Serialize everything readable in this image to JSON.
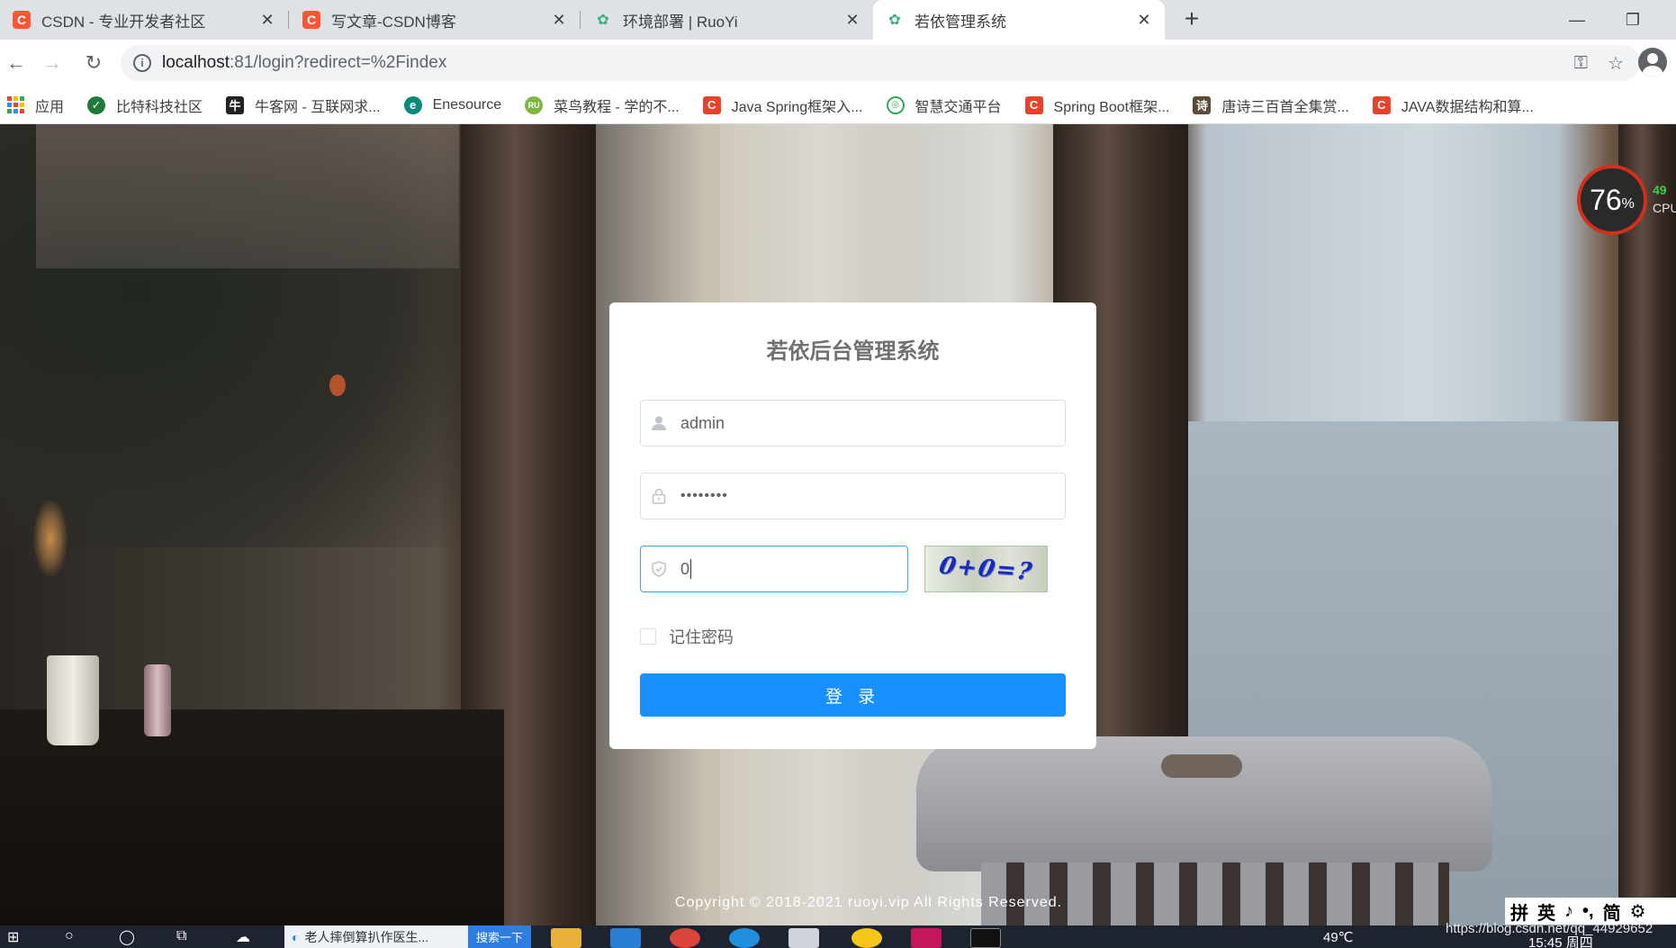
{
  "browser": {
    "tabs": [
      {
        "title": "CSDN - 专业开发者社区",
        "favicon": "C",
        "favicon_color": "#fc5531",
        "active": false
      },
      {
        "title": "写文章-CSDN博客",
        "favicon": "C",
        "favicon_color": "#fc5531",
        "active": false
      },
      {
        "title": "环境部署 | RuoYi",
        "favicon": "ruoyi-leaf-icon",
        "active": false
      },
      {
        "title": "若依管理系统",
        "favicon": "ruoyi-leaf-icon",
        "active": true
      }
    ],
    "new_tab": "+",
    "window_controls": {
      "minimize": "—",
      "restore": "❐"
    },
    "url_host": "localhost",
    "url_rest": ":81/login?redirect=%2Findex",
    "bookmarks": [
      {
        "label": "应用",
        "icon": "apps-grid-icon"
      },
      {
        "label": "比特科技社区",
        "icon": "bite-icon",
        "color": "#1e7b3a"
      },
      {
        "label": "牛客网 - 互联网求...",
        "icon": "nowcoder-icon",
        "color": "#222222"
      },
      {
        "label": "Enesource",
        "icon": "enesource-icon",
        "color": "#0a8a7a"
      },
      {
        "label": "菜鸟教程 - 学的不...",
        "icon": "runoob-icon",
        "color": "#7fb640"
      },
      {
        "label": "Java Spring框架入...",
        "icon": "csdn-icon",
        "color": "#e8412c"
      },
      {
        "label": "智慧交通平台",
        "icon": "traffic-icon",
        "color": "#3aa856"
      },
      {
        "label": "Spring Boot框架...",
        "icon": "csdn-icon",
        "color": "#e8412c"
      },
      {
        "label": "唐诗三百首全集赏...",
        "icon": "poem-icon",
        "color": "#5a4a3a"
      },
      {
        "label": "JAVA数据结构和算...",
        "icon": "csdn-icon",
        "color": "#e8412c"
      }
    ]
  },
  "login": {
    "title": "若依后台管理系统",
    "username": "admin",
    "password_mask": "••••••••",
    "captcha_input": "0",
    "captcha_image_text": "0+0=?",
    "remember_label": "记住密码",
    "remember_checked": false,
    "submit_label": "登 录",
    "accent_color": "#1890ff"
  },
  "footer": {
    "copyright": "Copyright © 2018-2021 ruoyi.vip All Rights Reserved."
  },
  "cpu_widget": {
    "percent": "76",
    "percent_sign": "%",
    "side_value": "49",
    "label": "CPU"
  },
  "ime": [
    "拼",
    "英",
    "♪",
    "•,",
    "简",
    "⚙"
  ],
  "taskbar": {
    "edge_tab": "老人摔倒算扒作医生...",
    "search_btn": "搜索一下",
    "temperature": "49℃",
    "time": "15:45 周四",
    "watermark": "https://blog.csdn.net/qq_44929652"
  }
}
